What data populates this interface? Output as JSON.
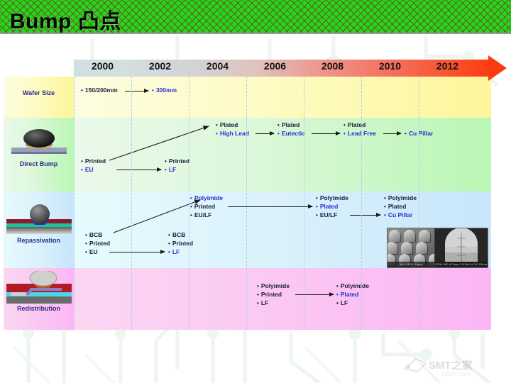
{
  "slide": {
    "title": "Bump 凸点"
  },
  "timeline": {
    "years": [
      "2000",
      "2002",
      "2004",
      "2006",
      "2008",
      "2010",
      "2012"
    ],
    "arrow_name": "timeline-arrow",
    "start_color": "#cfe0e2",
    "end_color": "#fb3c12"
  },
  "rows": [
    {
      "id": "wafer-size",
      "label": "Wafer Size",
      "background": "#fefbc4",
      "items": [
        {
          "text": "150/200mm",
          "style": "dark"
        },
        {
          "text": "300mm",
          "style": "blue"
        }
      ]
    },
    {
      "id": "direct-bump",
      "label": "Direct Bump",
      "background": "#dbf7d9",
      "items": [
        {
          "text": "Printed",
          "style": "dark"
        },
        {
          "text": "EU",
          "style": "blue"
        },
        {
          "text": "Printed",
          "style": "dark"
        },
        {
          "text": "LF",
          "style": "blue"
        },
        {
          "text": "Plated",
          "style": "dark"
        },
        {
          "text": "High Lead",
          "style": "blue"
        },
        {
          "text": "Plated",
          "style": "dark"
        },
        {
          "text": "Eutectic",
          "style": "blue"
        },
        {
          "text": "Plated",
          "style": "dark"
        },
        {
          "text": "Lead Free",
          "style": "blue"
        },
        {
          "text": "Cu Pillar",
          "style": "blue"
        }
      ]
    },
    {
      "id": "repassivation",
      "label": "Repassivation",
      "background": "#dcf2fb",
      "items": [
        {
          "text": "BCB",
          "style": "dark"
        },
        {
          "text": "Printed",
          "style": "dark"
        },
        {
          "text": "EU",
          "style": "dark"
        },
        {
          "text": "BCB",
          "style": "dark"
        },
        {
          "text": "Printed",
          "style": "dark"
        },
        {
          "text": "LF",
          "style": "blue"
        },
        {
          "text": "Polyimide",
          "style": "blue"
        },
        {
          "text": "Printed",
          "style": "dark"
        },
        {
          "text": "EU/LF",
          "style": "dark"
        },
        {
          "text": "Polyimide",
          "style": "dark"
        },
        {
          "text": "Plated",
          "style": "blue"
        },
        {
          "text": "EU/LF",
          "style": "dark"
        },
        {
          "text": "Polyimide",
          "style": "dark"
        },
        {
          "text": "Plated",
          "style": "dark"
        },
        {
          "text": "Cu Pillar",
          "style": "blue"
        }
      ]
    },
    {
      "id": "redistribution",
      "label": "Redistribution",
      "background": "#fbc9f2",
      "items": [
        {
          "text": "Polyimide",
          "style": "dark"
        },
        {
          "text": "Printed",
          "style": "dark"
        },
        {
          "text": "LF",
          "style": "dark"
        },
        {
          "text": "Polyimide",
          "style": "dark"
        },
        {
          "text": "Plated",
          "style": "blue"
        },
        {
          "text": "LF",
          "style": "dark"
        }
      ]
    }
  ],
  "cells": {
    "wafer": {
      "a": "150/200mm",
      "b": "300mm"
    },
    "direct": {
      "a1": "Printed",
      "a2": "EU",
      "b1": "Printed",
      "b2": "LF",
      "c1": "Plated",
      "c2": "High Lead",
      "d1": "Plated",
      "d2": "Eutectic",
      "e1": "Plated",
      "e2": "Lead Free",
      "f1": "Cu Pillar"
    },
    "repass": {
      "a1": "BCB",
      "a2": "Printed",
      "a3": "EU",
      "b1": "BCB",
      "b2": "Printed",
      "b3": "LF",
      "c1": "Polyimide",
      "c2": "Printed",
      "c3": "EU/LF",
      "d1": "Polyimide",
      "d2": "Plated",
      "d3": "EU/LF",
      "e1": "Polyimide",
      "e2": "Plated",
      "e3": "Cu Pillar"
    },
    "redist": {
      "a1": "Polyimide",
      "a2": "Printed",
      "a3": "LF",
      "b1": "Polyimide",
      "b2": "Plated",
      "b3": "LF"
    }
  },
  "sem": {
    "left_caption": "5kV  X500  10μm",
    "right_caption": "SEM  WD 8.2mm  15.0kV  x700   50um"
  },
  "watermark": {
    "text": "SMT之家",
    "sub": "cfans.com"
  }
}
